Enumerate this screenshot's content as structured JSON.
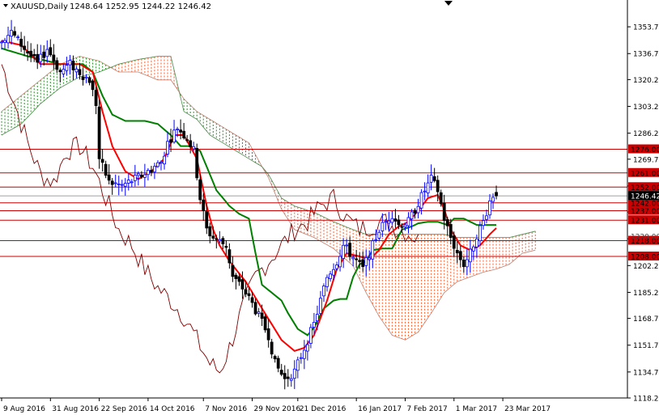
{
  "header": {
    "symbol_info": "XAUUSD,Daily",
    "ohlc": "1248.64 1252.95 1244.22 1246.42"
  },
  "chart_data": {
    "type": "candlestick",
    "symbol": "XAUUSD",
    "timeframe": "Daily",
    "last_quote": {
      "open": 1248.64,
      "high": 1252.95,
      "low": 1244.22,
      "close": 1246.42
    },
    "ylim": [
      1118.2,
      1370.7
    ],
    "y_ticks": [
      "1353.70",
      "1336.70",
      "1320.20",
      "1303.20",
      "1286.20",
      "1269.70",
      "1252.70",
      "1236.20",
      "1219.20",
      "1202.20",
      "1185.20",
      "1168.70",
      "1151.70",
      "1134.70",
      "1118.20"
    ],
    "x_labels": [
      "9 Aug 2016",
      "31 Aug 2016",
      "22 Sep 2016",
      "14 Oct 2016",
      "7 Nov 2016",
      "29 Nov 2016",
      "21 Dec 2016",
      "16 Jan 2017",
      "7 Feb 2017",
      "1 Mar 2017",
      "23 Mar 2017"
    ],
    "x_label_index": [
      0,
      15,
      30,
      45,
      62,
      77,
      91,
      109,
      124,
      139,
      154
    ],
    "n_bars": 160,
    "horizontal_levels": [
      1276.0,
      1261.0,
      1252.0,
      1242.0,
      1237.0,
      1231.0,
      1218.0,
      1208.0
    ],
    "level_labels": [
      "1276.00",
      "1261.00",
      "1252.00",
      "1242.00",
      "1237.00",
      "1231.00",
      "1218.00",
      "1208.00"
    ],
    "current_price": "1246.42",
    "hidden_level_label": "1220.00",
    "price_path_anchors": [
      [
        0,
        1345
      ],
      [
        4,
        1350
      ],
      [
        8,
        1340
      ],
      [
        12,
        1330
      ],
      [
        15,
        1340
      ],
      [
        19,
        1325
      ],
      [
        22,
        1330
      ],
      [
        26,
        1323
      ],
      [
        28,
        1320
      ],
      [
        30,
        1305
      ],
      [
        31,
        1270
      ],
      [
        34,
        1255
      ],
      [
        38,
        1253
      ],
      [
        42,
        1257
      ],
      [
        46,
        1262
      ],
      [
        50,
        1268
      ],
      [
        52,
        1280
      ],
      [
        55,
        1290
      ],
      [
        58,
        1283
      ],
      [
        60,
        1275
      ],
      [
        62,
        1245
      ],
      [
        64,
        1225
      ],
      [
        66,
        1220
      ],
      [
        70,
        1215
      ],
      [
        72,
        1195
      ],
      [
        75,
        1188
      ],
      [
        78,
        1178
      ],
      [
        80,
        1170
      ],
      [
        83,
        1158
      ],
      [
        85,
        1140
      ],
      [
        88,
        1130
      ],
      [
        91,
        1135
      ],
      [
        93,
        1145
      ],
      [
        95,
        1155
      ],
      [
        97,
        1165
      ],
      [
        99,
        1180
      ],
      [
        101,
        1195
      ],
      [
        104,
        1205
      ],
      [
        106,
        1215
      ],
      [
        108,
        1210
      ],
      [
        110,
        1205
      ],
      [
        112,
        1200
      ],
      [
        114,
        1210
      ],
      [
        117,
        1225
      ],
      [
        119,
        1230
      ],
      [
        121,
        1235
      ],
      [
        123,
        1228
      ],
      [
        126,
        1230
      ],
      [
        128,
        1238
      ],
      [
        131,
        1250
      ],
      [
        133,
        1257
      ],
      [
        135,
        1250
      ],
      [
        137,
        1232
      ],
      [
        139,
        1220
      ],
      [
        141,
        1210
      ],
      [
        143,
        1203
      ],
      [
        145,
        1210
      ],
      [
        147,
        1222
      ],
      [
        149,
        1230
      ],
      [
        151,
        1243
      ],
      [
        152,
        1247
      ]
    ],
    "tenkan_anchors": [
      [
        0,
        1345
      ],
      [
        6,
        1342
      ],
      [
        12,
        1330
      ],
      [
        18,
        1330
      ],
      [
        24,
        1330
      ],
      [
        28,
        1325
      ],
      [
        31,
        1300
      ],
      [
        34,
        1278
      ],
      [
        38,
        1262
      ],
      [
        42,
        1257
      ],
      [
        46,
        1262
      ],
      [
        50,
        1270
      ],
      [
        53,
        1285
      ],
      [
        56,
        1285
      ],
      [
        60,
        1270
      ],
      [
        63,
        1240
      ],
      [
        65,
        1225
      ],
      [
        67,
        1215
      ],
      [
        70,
        1205
      ],
      [
        75,
        1192
      ],
      [
        80,
        1175
      ],
      [
        83,
        1165
      ],
      [
        86,
        1155
      ],
      [
        90,
        1148
      ],
      [
        93,
        1150
      ],
      [
        96,
        1158
      ],
      [
        100,
        1180
      ],
      [
        103,
        1200
      ],
      [
        106,
        1210
      ],
      [
        110,
        1208
      ],
      [
        113,
        1206
      ],
      [
        116,
        1212
      ],
      [
        119,
        1222
      ],
      [
        122,
        1227
      ],
      [
        125,
        1230
      ],
      [
        128,
        1237
      ],
      [
        131,
        1245
      ],
      [
        134,
        1247
      ],
      [
        136,
        1238
      ],
      [
        138,
        1225
      ],
      [
        141,
        1215
      ],
      [
        144,
        1212
      ],
      [
        147,
        1215
      ],
      [
        150,
        1222
      ],
      [
        152,
        1226
      ]
    ],
    "kijun_anchors": [
      [
        0,
        1340
      ],
      [
        8,
        1335
      ],
      [
        12,
        1333
      ],
      [
        18,
        1330
      ],
      [
        25,
        1330
      ],
      [
        28,
        1325
      ],
      [
        31,
        1310
      ],
      [
        34,
        1298
      ],
      [
        38,
        1294
      ],
      [
        44,
        1294
      ],
      [
        48,
        1292
      ],
      [
        52,
        1285
      ],
      [
        55,
        1278
      ],
      [
        58,
        1278
      ],
      [
        61,
        1275
      ],
      [
        63,
        1265
      ],
      [
        66,
        1250
      ],
      [
        70,
        1240
      ],
      [
        73,
        1235
      ],
      [
        76,
        1232
      ],
      [
        78,
        1210
      ],
      [
        80,
        1190
      ],
      [
        83,
        1185
      ],
      [
        86,
        1180
      ],
      [
        88,
        1172
      ],
      [
        91,
        1162
      ],
      [
        94,
        1158
      ],
      [
        96,
        1163
      ],
      [
        99,
        1175
      ],
      [
        102,
        1180
      ],
      [
        104,
        1181
      ],
      [
        106,
        1181
      ],
      [
        108,
        1195
      ],
      [
        110,
        1203
      ],
      [
        112,
        1205
      ],
      [
        114,
        1212
      ],
      [
        117,
        1213
      ],
      [
        120,
        1213
      ],
      [
        123,
        1225
      ],
      [
        126,
        1227
      ],
      [
        128,
        1229
      ],
      [
        131,
        1230
      ],
      [
        134,
        1230
      ],
      [
        137,
        1228
      ],
      [
        139,
        1232
      ],
      [
        142,
        1232
      ],
      [
        146,
        1228
      ],
      [
        149,
        1228
      ],
      [
        152,
        1228
      ]
    ],
    "span_a_anchors": [
      [
        0,
        1300
      ],
      [
        6,
        1310
      ],
      [
        12,
        1320
      ],
      [
        18,
        1330
      ],
      [
        24,
        1335
      ],
      [
        30,
        1332
      ],
      [
        36,
        1325
      ],
      [
        42,
        1325
      ],
      [
        48,
        1320
      ],
      [
        52,
        1320
      ],
      [
        56,
        1308
      ],
      [
        60,
        1300
      ],
      [
        64,
        1295
      ],
      [
        68,
        1290
      ],
      [
        72,
        1285
      ],
      [
        76,
        1280
      ],
      [
        80,
        1265
      ],
      [
        82,
        1258
      ],
      [
        86,
        1238
      ],
      [
        90,
        1225
      ],
      [
        96,
        1220
      ],
      [
        102,
        1213
      ],
      [
        108,
        1202
      ],
      [
        112,
        1185
      ],
      [
        116,
        1170
      ],
      [
        120,
        1158
      ],
      [
        124,
        1155
      ],
      [
        128,
        1160
      ],
      [
        132,
        1172
      ],
      [
        136,
        1185
      ],
      [
        140,
        1192
      ],
      [
        144,
        1195
      ],
      [
        148,
        1198
      ],
      [
        152,
        1200
      ],
      [
        156,
        1203
      ],
      [
        160,
        1210
      ],
      [
        164,
        1212
      ]
    ],
    "span_b_anchors": [
      [
        0,
        1285
      ],
      [
        6,
        1292
      ],
      [
        12,
        1305
      ],
      [
        18,
        1315
      ],
      [
        24,
        1322
      ],
      [
        30,
        1325
      ],
      [
        36,
        1330
      ],
      [
        42,
        1333
      ],
      [
        48,
        1335
      ],
      [
        52,
        1335
      ],
      [
        56,
        1300
      ],
      [
        60,
        1295
      ],
      [
        64,
        1285
      ],
      [
        68,
        1280
      ],
      [
        72,
        1275
      ],
      [
        76,
        1270
      ],
      [
        80,
        1265
      ],
      [
        82,
        1260
      ],
      [
        86,
        1245
      ],
      [
        90,
        1240
      ],
      [
        96,
        1236
      ],
      [
        102,
        1230
      ],
      [
        108,
        1225
      ],
      [
        112,
        1222
      ],
      [
        116,
        1222
      ],
      [
        120,
        1222
      ],
      [
        124,
        1222
      ],
      [
        128,
        1222
      ],
      [
        132,
        1222
      ],
      [
        136,
        1222
      ],
      [
        140,
        1220
      ],
      [
        144,
        1220
      ],
      [
        148,
        1220
      ],
      [
        152,
        1220
      ],
      [
        156,
        1220
      ],
      [
        160,
        1222
      ],
      [
        164,
        1224
      ]
    ],
    "chikou_anchors": [
      [
        0,
        1330
      ],
      [
        4,
        1305
      ],
      [
        8,
        1280
      ],
      [
        12,
        1260
      ],
      [
        16,
        1255
      ],
      [
        20,
        1275
      ],
      [
        24,
        1278
      ],
      [
        28,
        1265
      ],
      [
        32,
        1245
      ],
      [
        36,
        1225
      ],
      [
        40,
        1215
      ],
      [
        44,
        1200
      ],
      [
        48,
        1188
      ],
      [
        52,
        1180
      ],
      [
        56,
        1170
      ],
      [
        60,
        1155
      ],
      [
        64,
        1140
      ],
      [
        67,
        1135
      ],
      [
        70,
        1150
      ],
      [
        74,
        1175
      ],
      [
        78,
        1195
      ],
      [
        82,
        1205
      ],
      [
        86,
        1215
      ],
      [
        90,
        1225
      ],
      [
        94,
        1230
      ],
      [
        98,
        1240
      ],
      [
        102,
        1245
      ],
      [
        106,
        1232
      ],
      [
        110,
        1225
      ],
      [
        114,
        1228
      ],
      [
        118,
        1230
      ],
      [
        122,
        1225
      ],
      [
        126,
        1222
      ],
      [
        128,
        1218
      ]
    ],
    "colors": {
      "bull_candle": "#0000ff",
      "bear_candle": "#000000",
      "tenkan": "#ff0000",
      "kijun": "#008000",
      "chikou": "#800000",
      "cloud_bull": "#008000",
      "cloud_bear": "#ff4000",
      "level_line": "#cc0000",
      "level_label_bg": "#cc0000",
      "current_price_bg": "#000000"
    }
  }
}
